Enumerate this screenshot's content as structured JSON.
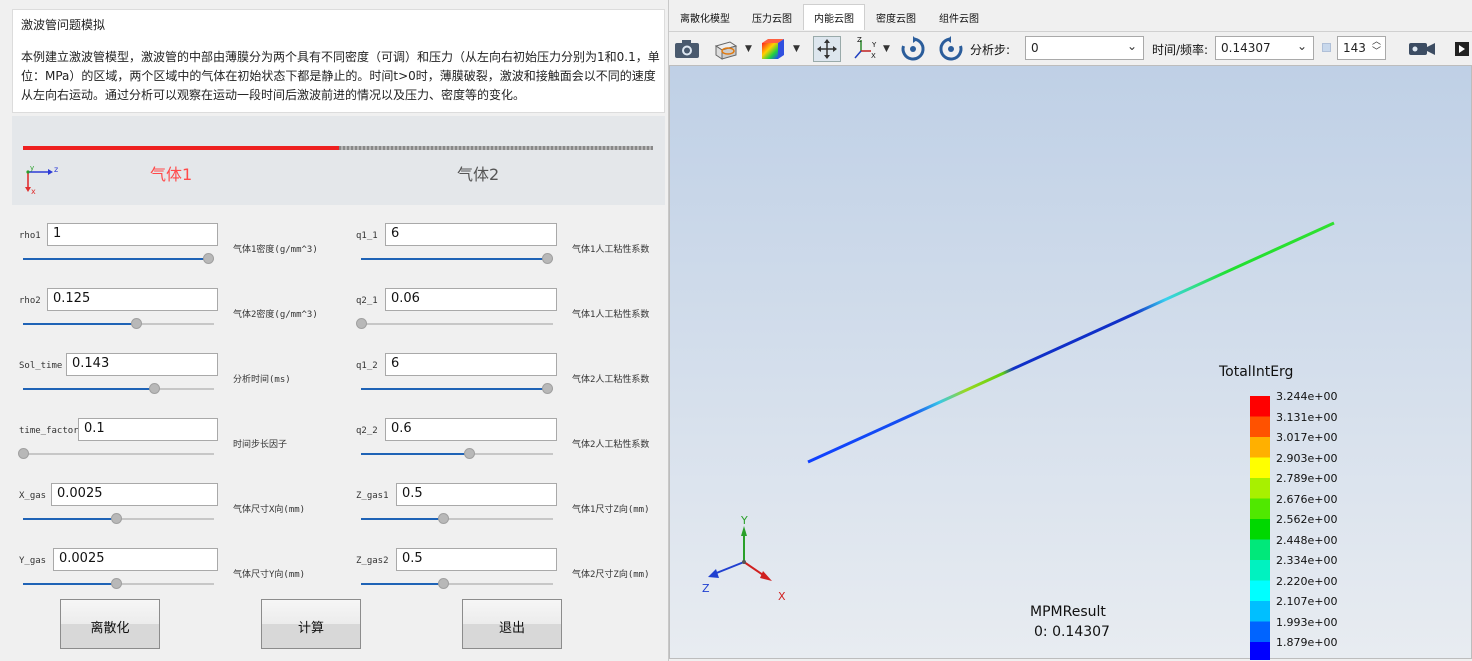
{
  "description": {
    "title": "激波管问题模拟",
    "text": "本例建立激波管模型，激波管的中部由薄膜分为两个具有不同密度（可调）和压力（从左向右初始压力分别为1和0.1，单位：MPa）的区域，两个区域中的气体在初始状态下都是静止的。时间t>0时，薄膜破裂，激波和接触面会以不同的速度从左向右运动。通过分析可以观察在运动一段时间后激波前进的情况以及压力、密度等的变化。"
  },
  "diagram": {
    "gas1_label": "气体1",
    "gas2_label": "气体2",
    "axis_y": "y",
    "axis_z": "z",
    "axis_x": "x"
  },
  "params_left": [
    {
      "label": "rho1",
      "value": "1",
      "desc": "气体1密度(g/mm^3)",
      "slider": 1.0
    },
    {
      "label": "rho2",
      "value": "0.125",
      "desc": "气体2密度(g/mm^3)",
      "slider": 0.61
    },
    {
      "label": "Sol_time",
      "value": "0.143",
      "desc": "分析时间(ms)",
      "slider": 0.71
    },
    {
      "label": "time_factor",
      "value": "0.1",
      "desc": "时间步长因子",
      "slider": 0.0
    },
    {
      "label": "X_gas",
      "value": "0.0025",
      "desc": "气体尺寸X向(mm)",
      "slider": 0.5
    },
    {
      "label": "Y_gas",
      "value": "0.0025",
      "desc": "气体尺寸Y向(mm)",
      "slider": 0.5
    }
  ],
  "params_right": [
    {
      "label": "q1_1",
      "value": "6",
      "desc": "气体1人工粘性系数",
      "slider": 1.0
    },
    {
      "label": "q2_1",
      "value": "0.06",
      "desc": "气体1人工粘性系数",
      "slider": 0.0
    },
    {
      "label": "q1_2",
      "value": "6",
      "desc": "气体2人工粘性系数",
      "slider": 1.0
    },
    {
      "label": "q2_2",
      "value": "0.6",
      "desc": "气体2人工粘性系数",
      "slider": 0.58
    },
    {
      "label": "Z_gas1",
      "value": "0.5",
      "desc": "气体1尺寸Z向(mm)",
      "slider": 0.44
    },
    {
      "label": "Z_gas2",
      "value": "0.5",
      "desc": "气体2尺寸Z向(mm)",
      "slider": 0.44
    }
  ],
  "buttons": {
    "discretize": "离散化",
    "compute": "计算",
    "exit": "退出"
  },
  "tabs": [
    {
      "label": "离散化模型",
      "active": false
    },
    {
      "label": "压力云图",
      "active": false
    },
    {
      "label": "内能云图",
      "active": true
    },
    {
      "label": "密度云图",
      "active": false
    },
    {
      "label": "组件云图",
      "active": false
    }
  ],
  "toolbar": {
    "step_label": "分析步:",
    "step_value": "0",
    "time_label": "时间/频率:",
    "time_value": "0.14307",
    "frame_value": "143",
    "icons": [
      "camera-icon",
      "section-plane-icon",
      "color-cube-icon",
      "fit-view-icon",
      "axes-orient-icon",
      "rotate-cw-icon",
      "rotate-ccw-icon",
      "video-icon",
      "next-icon"
    ]
  },
  "viewport": {
    "triad": {
      "x": "X",
      "y": "Y",
      "z": "Z"
    },
    "result_name": "MPMResult",
    "result_step": "0: 0.14307",
    "legend": {
      "title": "TotalIntErg",
      "labels": [
        "3.244e+00",
        "3.131e+00",
        "3.017e+00",
        "2.903e+00",
        "2.789e+00",
        "2.676e+00",
        "2.562e+00",
        "2.448e+00",
        "2.334e+00",
        "2.220e+00",
        "2.107e+00",
        "1.993e+00",
        "1.879e+00"
      ],
      "colors": [
        "#ff0000",
        "#ff5200",
        "#ffb000",
        "#ffff00",
        "#a8f000",
        "#50e800",
        "#00d800",
        "#00e87a",
        "#00f2c0",
        "#00ffff",
        "#00bfff",
        "#0064ff",
        "#0000ff"
      ]
    }
  }
}
